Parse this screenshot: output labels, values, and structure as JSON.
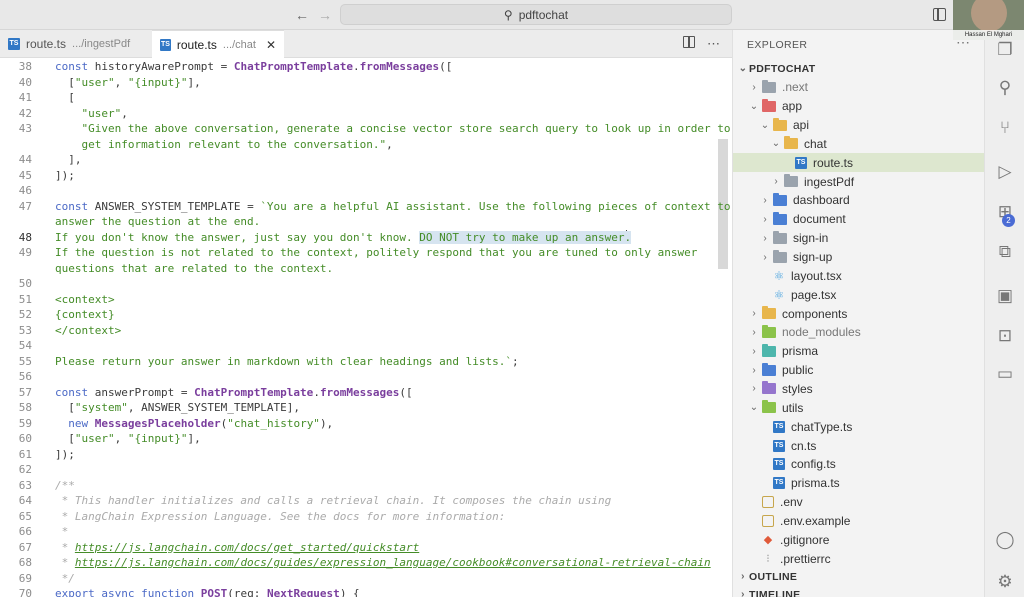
{
  "titlebar": {
    "search_text": "pdftochat",
    "back_arrow": "←",
    "forward_arrow": "→"
  },
  "tabs": [
    {
      "label": "route.ts",
      "desc": ".../ingestPdf",
      "active": false
    },
    {
      "label": "route.ts",
      "desc": ".../chat",
      "active": true,
      "close": "✕"
    }
  ],
  "editor_actions": {
    "more": "⋯"
  },
  "code_lines": [
    {
      "num": "38",
      "html": "<span class=\"kw\">const</span> historyAwarePrompt = <span class=\"fn\">ChatPromptTemplate</span>.<span class=\"fn\">fromMessages</span>(["
    },
    {
      "num": "40",
      "html": "  [<span class=\"str\">\"user\"</span>, <span class=\"str\">\"{input}\"</span>],"
    },
    {
      "num": "41",
      "html": "  ["
    },
    {
      "num": "42",
      "html": "    <span class=\"str\">\"user\"</span>,"
    },
    {
      "num": "43",
      "html": "    <span class=\"str\">\"Given the above conversation, generate a concise vector store search query to look up in order to</span>"
    },
    {
      "num": "",
      "html": "    <span class=\"str\">get information relevant to the conversation.\"</span>,"
    },
    {
      "num": "44",
      "html": "  ],"
    },
    {
      "num": "45",
      "html": "]);"
    },
    {
      "num": "46",
      "html": ""
    },
    {
      "num": "47",
      "html": "<span class=\"kw\">const</span> ANSWER_SYSTEM_TEMPLATE = <span class=\"str\">`You are a helpful AI assistant. Use the following pieces of context to</span>"
    },
    {
      "num": "",
      "html": "<span class=\"str\">answer the question at the end.</span>"
    },
    {
      "num": "48",
      "html": "<span class=\"str\">If you don't know the answer, just say you don't know. <span class=\"sel\">DO NOT try to make up an answer.</span></span>",
      "current": true
    },
    {
      "num": "49",
      "html": "<span class=\"str\">If the question is not related to the context, politely respond that you are tuned to only answer</span>"
    },
    {
      "num": "",
      "html": "<span class=\"str\">questions that are related to the context.</span>"
    },
    {
      "num": "50",
      "html": ""
    },
    {
      "num": "51",
      "html": "<span class=\"str\">&lt;context&gt;</span>"
    },
    {
      "num": "52",
      "html": "<span class=\"str\">{context}</span>"
    },
    {
      "num": "53",
      "html": "<span class=\"str\">&lt;/context&gt;</span>"
    },
    {
      "num": "54",
      "html": ""
    },
    {
      "num": "55",
      "html": "<span class=\"str\">Please return your answer in markdown with clear headings and lists.`</span>;"
    },
    {
      "num": "56",
      "html": ""
    },
    {
      "num": "57",
      "html": "<span class=\"kw\">const</span> answerPrompt = <span class=\"fn\">ChatPromptTemplate</span>.<span class=\"fn\">fromMessages</span>(["
    },
    {
      "num": "58",
      "html": "  [<span class=\"str\">\"system\"</span>, ANSWER_SYSTEM_TEMPLATE],"
    },
    {
      "num": "59",
      "html": "  <span class=\"kw\">new</span> <span class=\"fn\">MessagesPlaceholder</span>(<span class=\"str\">\"chat_history\"</span>),"
    },
    {
      "num": "60",
      "html": "  [<span class=\"str\">\"user\"</span>, <span class=\"str\">\"{input}\"</span>],"
    },
    {
      "num": "61",
      "html": "]);"
    },
    {
      "num": "62",
      "html": ""
    },
    {
      "num": "63",
      "html": "<span class=\"cm\">/**</span>"
    },
    {
      "num": "64",
      "html": "<span class=\"cm\"> * This handler initializes and calls a retrieval chain. It composes the chain using</span>"
    },
    {
      "num": "65",
      "html": "<span class=\"cm\"> * LangChain Expression Language. See the docs for more information:</span>"
    },
    {
      "num": "66",
      "html": "<span class=\"cm\"> *</span>"
    },
    {
      "num": "67",
      "html": "<span class=\"cm\"> * </span><span class=\"cm-link\">https://js.langchain.com/docs/get_started/quickstart</span>"
    },
    {
      "num": "68",
      "html": "<span class=\"cm\"> * </span><span class=\"cm-link\">https://js.langchain.com/docs/guides/expression_language/cookbook#conversational-retrieval-chain</span>"
    },
    {
      "num": "69",
      "html": "<span class=\"cm\"> */</span>"
    },
    {
      "num": "70",
      "html": "<span class=\"kw\">export async function</span> <span class=\"fn\">POST</span>(req: <span class=\"fn\">NextRequest</span>) {"
    }
  ],
  "explorer": {
    "title": "EXPLORER",
    "more": "⋯",
    "tree": [
      {
        "label": "PDFTOCHAT",
        "indent": 0,
        "chev": "⌄",
        "kind": "section"
      },
      {
        "label": ".next",
        "indent": 1,
        "chev": "›",
        "kind": "folder",
        "color": "f-gray",
        "dim": true
      },
      {
        "label": "app",
        "indent": 1,
        "chev": "⌄",
        "kind": "folder",
        "color": "f-red"
      },
      {
        "label": "api",
        "indent": 2,
        "chev": "⌄",
        "kind": "folder",
        "color": "f-yellow"
      },
      {
        "label": "chat",
        "indent": 3,
        "chev": "⌄",
        "kind": "folder",
        "color": "f-yellow"
      },
      {
        "label": "route.ts",
        "indent": 4,
        "chev": "",
        "kind": "ts",
        "active": true
      },
      {
        "label": "ingestPdf",
        "indent": 3,
        "chev": "›",
        "kind": "folder",
        "color": "f-gray"
      },
      {
        "label": "dashboard",
        "indent": 2,
        "chev": "›",
        "kind": "folder",
        "color": "f-blue"
      },
      {
        "label": "document",
        "indent": 2,
        "chev": "›",
        "kind": "folder",
        "color": "f-blue"
      },
      {
        "label": "sign-in",
        "indent": 2,
        "chev": "›",
        "kind": "folder",
        "color": "f-gray"
      },
      {
        "label": "sign-up",
        "indent": 2,
        "chev": "›",
        "kind": "folder",
        "color": "f-gray"
      },
      {
        "label": "layout.tsx",
        "indent": 2,
        "chev": "",
        "kind": "react"
      },
      {
        "label": "page.tsx",
        "indent": 2,
        "chev": "",
        "kind": "react"
      },
      {
        "label": "components",
        "indent": 1,
        "chev": "›",
        "kind": "folder",
        "color": "f-yellow"
      },
      {
        "label": "node_modules",
        "indent": 1,
        "chev": "›",
        "kind": "folder",
        "color": "f-green",
        "dim": true
      },
      {
        "label": "prisma",
        "indent": 1,
        "chev": "›",
        "kind": "folder",
        "color": "f-teal"
      },
      {
        "label": "public",
        "indent": 1,
        "chev": "›",
        "kind": "folder",
        "color": "f-blue"
      },
      {
        "label": "styles",
        "indent": 1,
        "chev": "›",
        "kind": "folder",
        "color": "f-purple"
      },
      {
        "label": "utils",
        "indent": 1,
        "chev": "⌄",
        "kind": "folder",
        "color": "f-green"
      },
      {
        "label": "chatType.ts",
        "indent": 2,
        "chev": "",
        "kind": "ts"
      },
      {
        "label": "cn.ts",
        "indent": 2,
        "chev": "",
        "kind": "ts"
      },
      {
        "label": "config.ts",
        "indent": 2,
        "chev": "",
        "kind": "ts"
      },
      {
        "label": "prisma.ts",
        "indent": 2,
        "chev": "",
        "kind": "ts"
      },
      {
        "label": ".env",
        "indent": 1,
        "chev": "",
        "kind": "dot"
      },
      {
        "label": ".env.example",
        "indent": 1,
        "chev": "",
        "kind": "dot"
      },
      {
        "label": ".gitignore",
        "indent": 1,
        "chev": "",
        "kind": "git"
      },
      {
        "label": ".prettierrc",
        "indent": 1,
        "chev": "",
        "kind": "pret"
      },
      {
        "label": "OUTLINE",
        "indent": 0,
        "chev": "›",
        "kind": "section"
      },
      {
        "label": "TIMELINE",
        "indent": 0,
        "chev": "›",
        "kind": "section"
      }
    ]
  },
  "activity": {
    "items": [
      {
        "name": "explorer-icon",
        "glyph": "❐"
      },
      {
        "name": "search-icon",
        "glyph": "⚲"
      },
      {
        "name": "source-control-icon",
        "glyph": "⑂"
      },
      {
        "name": "run-debug-icon",
        "glyph": "▷"
      },
      {
        "name": "extensions-icon",
        "glyph": "⊞"
      },
      {
        "name": "remote-icon",
        "glyph": "⧉"
      },
      {
        "name": "api-icon",
        "glyph": "▣"
      },
      {
        "name": "docker-icon",
        "glyph": "⊡"
      },
      {
        "name": "chat-icon",
        "glyph": "▭"
      },
      {
        "name": "account-icon",
        "glyph": "◯"
      },
      {
        "name": "settings-icon",
        "glyph": "⚙"
      }
    ],
    "badge": "2"
  },
  "webcam": {
    "name": "Hassan El Mghari"
  }
}
